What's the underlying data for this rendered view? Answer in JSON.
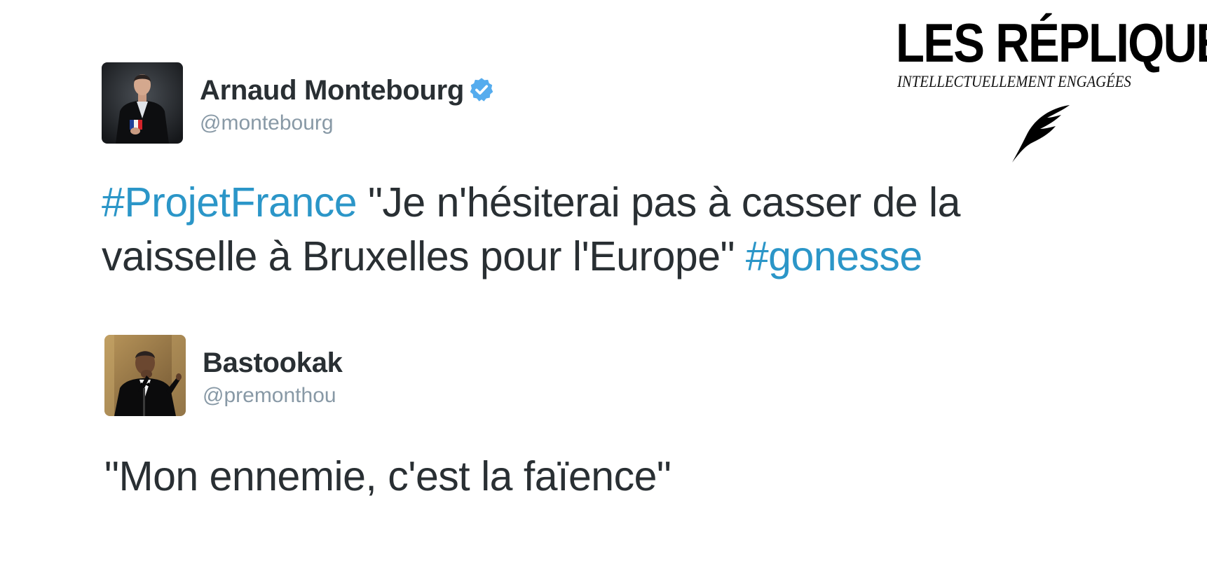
{
  "brand": {
    "title": "LES RÉPLIQUES",
    "tagline": "INTELLECTUELLEMENT ENGAGÉES",
    "icon": "quill-icon"
  },
  "colors": {
    "hashtag": "#2b96c8",
    "handle": "#8899a6",
    "text": "#292f33",
    "verified": "#55acee"
  },
  "tweets": [
    {
      "display_name": "Arnaud Montebourg",
      "verified": true,
      "handle": "@montebourg",
      "text_parts": {
        "hashtag_1": "#ProjetFrance",
        "body": " \"Je n'hésiterai pas à casser de la vaisselle à Bruxelles pour l'Europe\" ",
        "hashtag_2": "#gonesse"
      }
    },
    {
      "display_name": "Bastookak",
      "verified": false,
      "handle": "@premonthou",
      "text": "\"Mon ennemie, c'est la faïence\""
    }
  ]
}
